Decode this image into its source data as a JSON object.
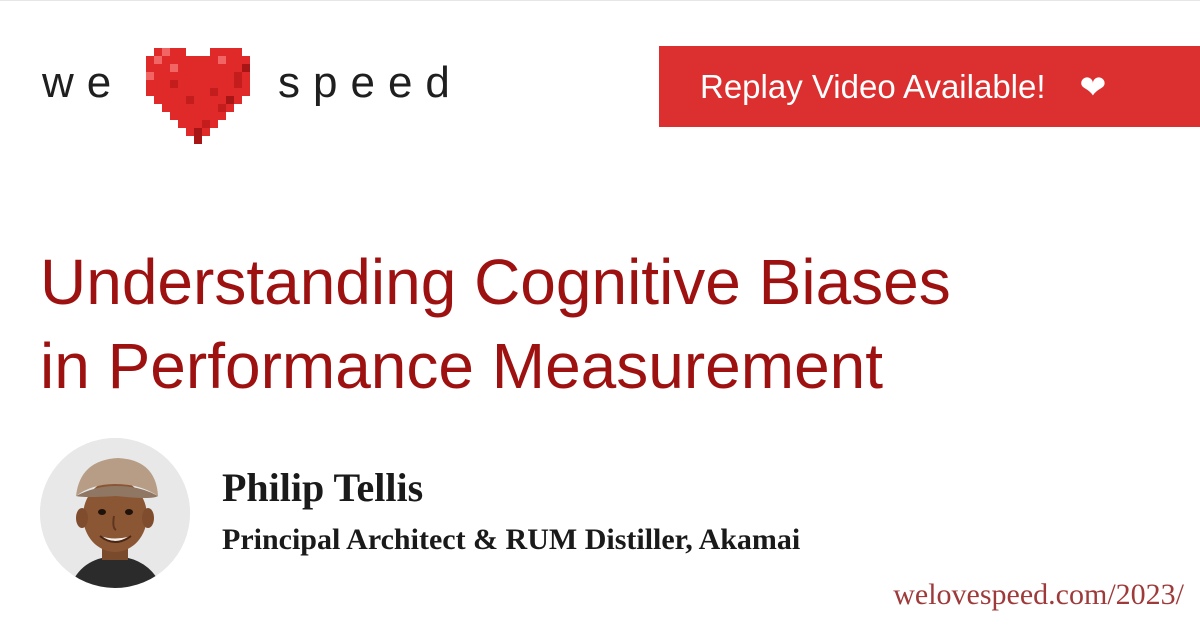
{
  "logo": {
    "word_left": "we",
    "word_right": "speed",
    "heart_icon": "pixel-heart-icon"
  },
  "banner": {
    "label": "Replay Video Available!",
    "icon": "heart-icon",
    "heart_char": "❤"
  },
  "talk": {
    "title_line1": "Understanding Cognitive Biases",
    "title_line2": "in Performance Measurement"
  },
  "speaker": {
    "name": "Philip Tellis",
    "role": "Principal Architect & RUM Distiller, Akamai"
  },
  "footer": {
    "url": "welovespeed.com/2023/"
  },
  "colors": {
    "accent": "#dc2f2f",
    "title": "#9e1111",
    "url": "#9e3a3a",
    "heart_light": "#f15a5a",
    "heart_dark": "#b71818"
  }
}
